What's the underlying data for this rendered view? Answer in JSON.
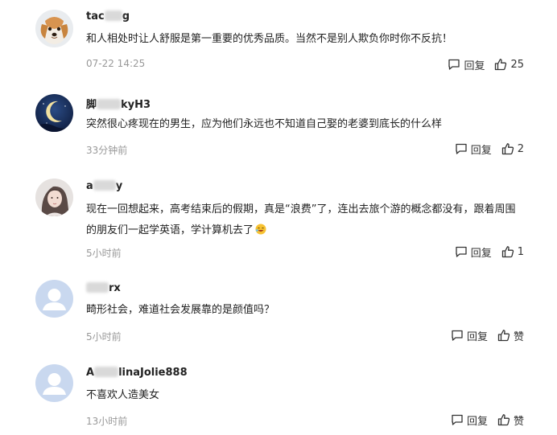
{
  "comments": [
    {
      "name_prefix": "tac",
      "name_suffix": "g",
      "text": "和人相处时让人舒服是第一重要的优秀品质。当然不是别人欺负你时你不反抗！",
      "time": "07-22 14:25",
      "reply_label": "回复",
      "like_label": "25",
      "avatar": "puppy-avatar"
    },
    {
      "name_prefix": "脚",
      "name_suffix": "kyH3",
      "text": "突然很心疼现在的男生，应为他们永远也不知道自己娶的老婆到底长的什么样",
      "time": "33分钟前",
      "reply_label": "回复",
      "like_label": "2",
      "avatar": "moon-night-avatar"
    },
    {
      "name_prefix": "a",
      "name_suffix": "y",
      "text": "现在一回想起来，高考结束后的假期，真是“浪费”了，连出去旅个游的概念都没有，跟着周围的朋友们一起学英语，学计算机去了",
      "time": "5小时前",
      "reply_label": "回复",
      "like_label": "1",
      "avatar": "girl-photo-avatar"
    },
    {
      "name_prefix": "",
      "name_suffix": "rx",
      "text": "畸形社会，难道社会发展靠的是颜值吗？",
      "time": "5小时前",
      "reply_label": "回复",
      "like_label": "赞",
      "avatar": "default-user-avatar"
    },
    {
      "name_prefix": "A",
      "name_suffix": "linaJolie888",
      "text": "不喜欢人造美女",
      "time": "13小时前",
      "reply_label": "回复",
      "like_label": "赞",
      "avatar": "default-user-avatar"
    }
  ],
  "colors": {
    "text": "#222222",
    "muted": "#999999",
    "default_avatar_bg": "#c9d8ef"
  }
}
